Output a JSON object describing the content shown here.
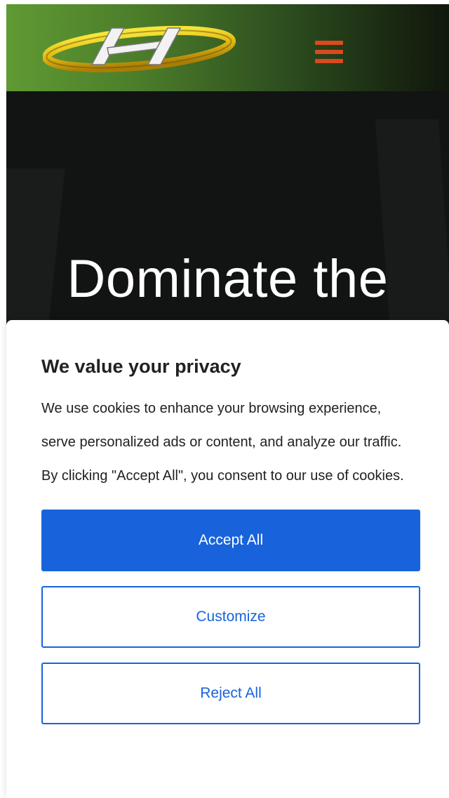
{
  "header": {
    "logo_name": "site-logo",
    "menu_icon": "hamburger-menu-icon",
    "menu_color": "#d94a1e"
  },
  "hero": {
    "title": "Dominate the"
  },
  "cookie_banner": {
    "title": "We value your privacy",
    "text": "We use cookies to enhance your browsing experience, serve personalized ads or content, and analyze our traffic. By clicking \"Accept All\", you consent to our use of cookies.",
    "accept_label": "Accept All",
    "customize_label": "Customize",
    "reject_label": "Reject All",
    "accent_color": "#1863dc"
  }
}
